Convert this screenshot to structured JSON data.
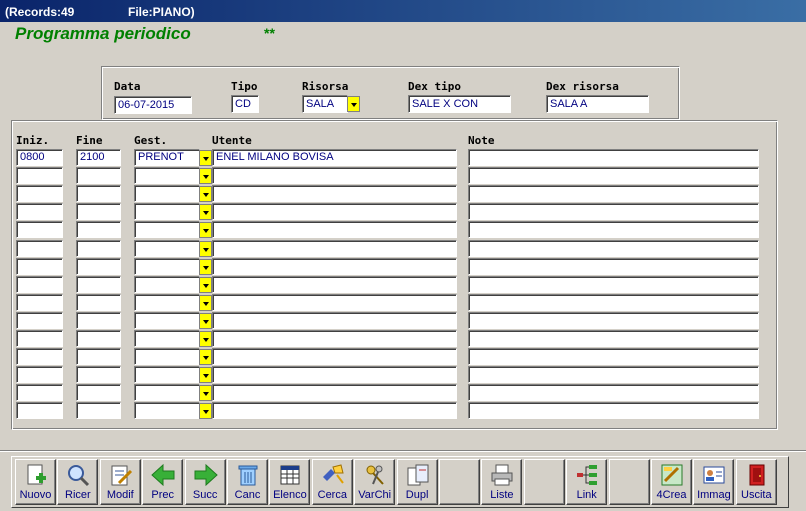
{
  "titlebar": {
    "records": "(Records:49",
    "file": "File:PIANO)"
  },
  "header": {
    "title": "Programma periodico",
    "stars": "**"
  },
  "form": {
    "data_label": "Data",
    "data_value": "06-07-2015",
    "tipo_label": "Tipo",
    "tipo_value": "CD",
    "risorsa_label": "Risorsa",
    "risorsa_value": "SALA",
    "dex_tipo_label": "Dex tipo",
    "dex_tipo_value": "SALE X CON",
    "dex_risorsa_label": "Dex risorsa",
    "dex_risorsa_value": "SALA A"
  },
  "grid": {
    "columns": [
      "Iniz.",
      "Fine",
      "Gest.",
      "Utente",
      "Note"
    ],
    "rows": [
      [
        "0800",
        "2100",
        "PRENOT",
        "ENEL MILANO BOVISA",
        ""
      ],
      [
        "",
        "",
        "",
        "",
        ""
      ],
      [
        "",
        "",
        "",
        "",
        ""
      ],
      [
        "",
        "",
        "",
        "",
        ""
      ],
      [
        "",
        "",
        "",
        "",
        ""
      ],
      [
        "",
        "",
        "",
        "",
        ""
      ],
      [
        "",
        "",
        "",
        "",
        ""
      ],
      [
        "",
        "",
        "",
        "",
        ""
      ],
      [
        "",
        "",
        "",
        "",
        ""
      ],
      [
        "",
        "",
        "",
        "",
        ""
      ],
      [
        "",
        "",
        "",
        "",
        ""
      ],
      [
        "",
        "",
        "",
        "",
        ""
      ],
      [
        "",
        "",
        "",
        "",
        ""
      ],
      [
        "",
        "",
        "",
        "",
        ""
      ],
      [
        "",
        "",
        "",
        "",
        ""
      ]
    ]
  },
  "toolbar": {
    "buttons": [
      {
        "name": "nuovo",
        "label": "Nuovo",
        "icon": "new-document-icon"
      },
      {
        "name": "ricer",
        "label": "Ricer",
        "icon": "magnifier-icon"
      },
      {
        "name": "modif",
        "label": "Modif",
        "icon": "edit-document-icon"
      },
      {
        "name": "prec",
        "label": "Prec",
        "icon": "arrow-left-icon"
      },
      {
        "name": "succ",
        "label": "Succ",
        "icon": "arrow-right-icon"
      },
      {
        "name": "canc",
        "label": "Canc",
        "icon": "trash-icon"
      },
      {
        "name": "elenco",
        "label": "Elenco",
        "icon": "table-icon"
      },
      {
        "name": "cerca",
        "label": "Cerca",
        "icon": "flashlight-icon"
      },
      {
        "name": "varchi",
        "label": "VarChi",
        "icon": "keys-icon"
      },
      {
        "name": "dupl",
        "label": "Dupl",
        "icon": "duplicate-icon"
      },
      {
        "name": "blank1",
        "label": "",
        "icon": ""
      },
      {
        "name": "liste",
        "label": "Liste",
        "icon": "printer-icon"
      },
      {
        "name": "blank2",
        "label": "",
        "icon": ""
      },
      {
        "name": "link",
        "label": "Link",
        "icon": "tree-icon"
      },
      {
        "name": "blank3",
        "label": "",
        "icon": ""
      },
      {
        "name": "4crea",
        "label": "4Crea",
        "icon": "create-icon"
      },
      {
        "name": "immag",
        "label": "Immag",
        "icon": "id-card-icon"
      },
      {
        "name": "uscita",
        "label": "Uscita",
        "icon": "exit-door-icon"
      }
    ]
  },
  "colors": {
    "title_green": "#008000",
    "field_text": "#000080",
    "dropdown_yellow": "#ffff00"
  }
}
